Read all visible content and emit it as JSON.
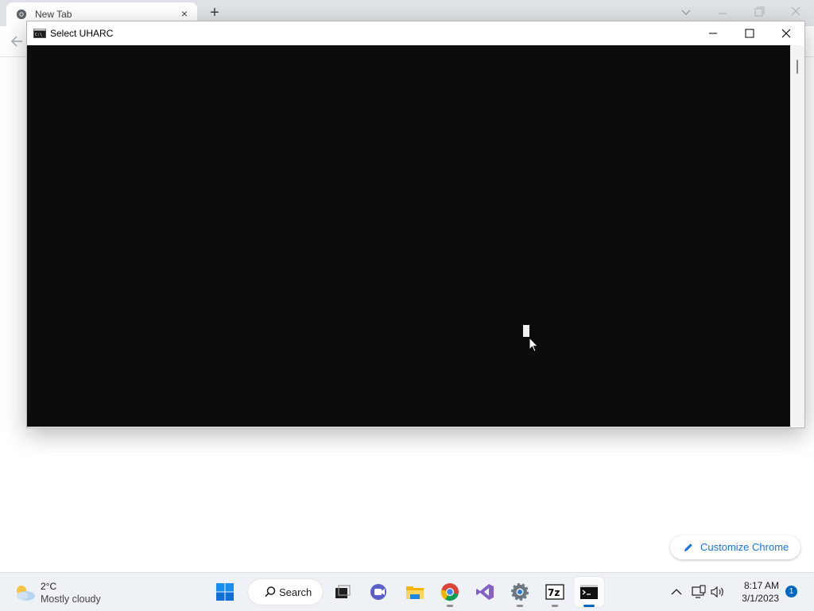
{
  "browser": {
    "tab": {
      "title": "New Tab",
      "close_symbol": "×"
    },
    "new_tab_symbol": "+",
    "customize_chrome_label": "Customize Chrome"
  },
  "console_window": {
    "title": "Select UHARC"
  },
  "taskbar": {
    "weather": {
      "temperature": "2°C",
      "condition": "Mostly cloudy",
      "icon": "cloud-sun-icon"
    },
    "search_label": "Search",
    "apps": [
      {
        "name": "start",
        "icon": "windows-logo-icon"
      },
      {
        "name": "task-view",
        "icon": "task-view-icon"
      },
      {
        "name": "meet",
        "icon": "video-call-icon"
      },
      {
        "name": "file-explorer",
        "icon": "folder-icon"
      },
      {
        "name": "chrome",
        "icon": "chrome-icon",
        "running": true
      },
      {
        "name": "visual-studio",
        "icon": "visual-studio-icon"
      },
      {
        "name": "settings",
        "icon": "gear-icon",
        "running": true
      },
      {
        "name": "7-zip",
        "icon": "7zip-icon",
        "label": "7z",
        "running": true
      },
      {
        "name": "command-prompt",
        "icon": "terminal-icon",
        "running": true,
        "active": true
      }
    ],
    "clock": {
      "time": "8:17 AM",
      "date": "3/1/2023"
    },
    "notification_count": "1"
  },
  "colors": {
    "console_background": "#0c0c0c",
    "taskbar_background": "#eef1f5",
    "accent": "#0067c0",
    "chrome_link": "#1a73e8"
  }
}
